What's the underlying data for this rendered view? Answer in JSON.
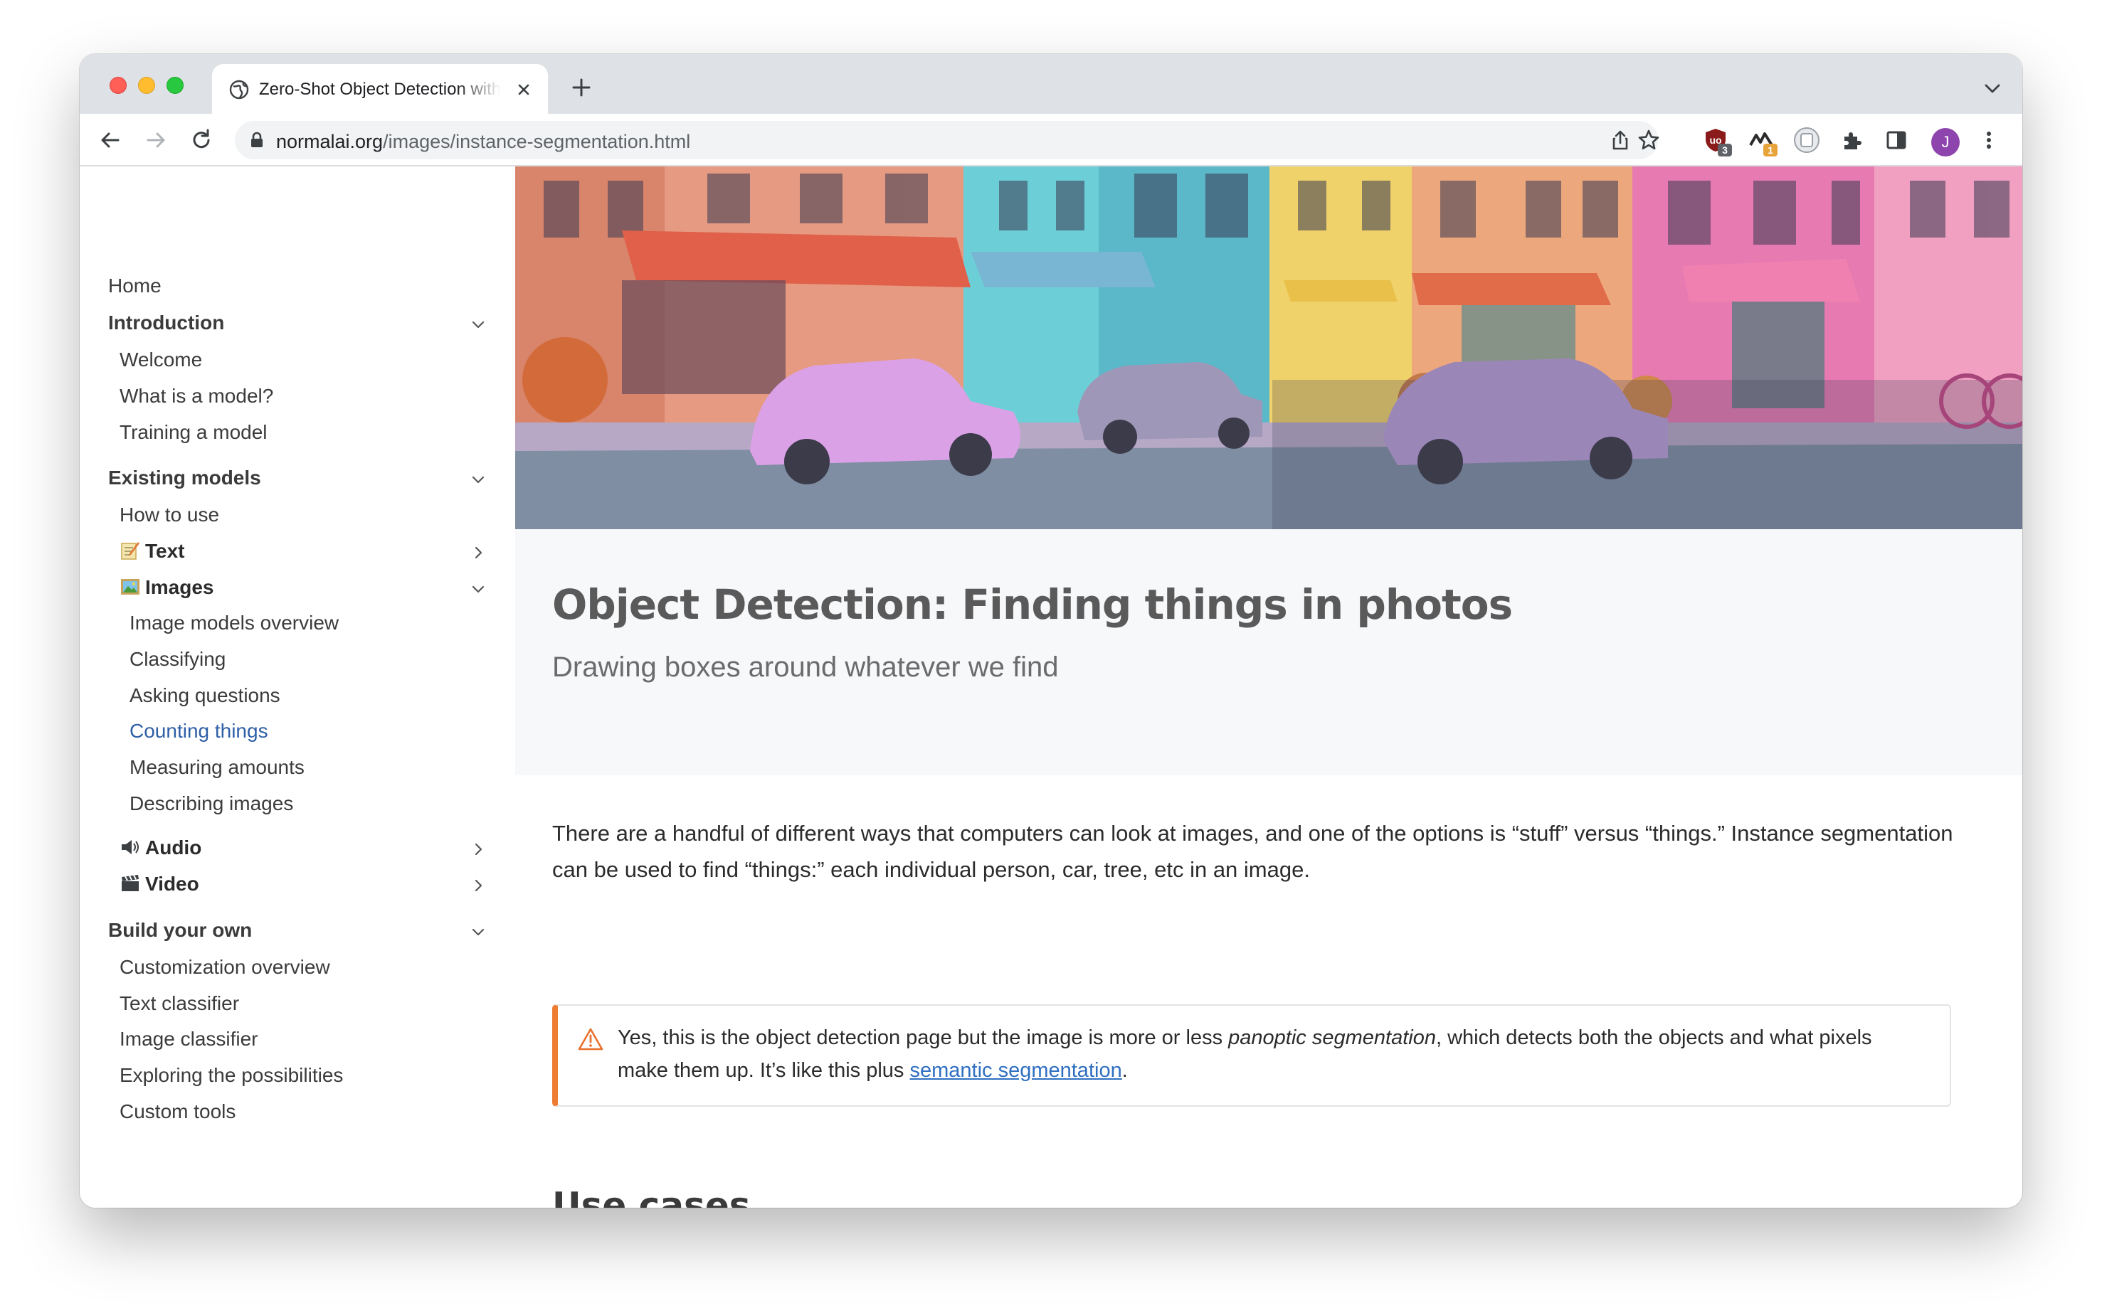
{
  "browser": {
    "tab_title": "Zero-Shot Object Detection with",
    "url_host": "normalai.org",
    "url_path": "/images/instance-segmentation.html",
    "extensions": [
      {
        "name": "ublock-origin-icon",
        "badge": "3",
        "badge_color": "#5f6368"
      },
      {
        "name": "wappalyzer-icon",
        "badge": "1",
        "badge_color": "#e8a33a"
      },
      {
        "name": "readability-icon",
        "badge": ""
      }
    ],
    "profile_initial": "J",
    "profile_color": "#8e44ad"
  },
  "sidebar": {
    "home": "Home",
    "introduction": {
      "label": "Introduction",
      "items": [
        "Welcome",
        "What is a model?",
        "Training a model"
      ]
    },
    "existing_models": {
      "label": "Existing models",
      "how_to_use": "How to use",
      "text": "Text",
      "images": {
        "label": "Images",
        "items": [
          "Image models overview",
          "Classifying",
          "Asking questions",
          "Counting things",
          "Measuring amounts",
          "Describing images"
        ],
        "active_item": "Counting things"
      },
      "audio": "Audio",
      "video": "Video"
    },
    "build_your_own": {
      "label": "Build your own",
      "items": [
        "Customization overview",
        "Text classifier",
        "Image classifier",
        "Exploring the possibilities",
        "Custom tools"
      ]
    }
  },
  "main": {
    "title": "Object Detection: Finding things in photos",
    "subtitle": "Drawing boxes around whatever we find",
    "intro_paragraph": "There are a handful of different ways that computers can look at images, and one of the options is “stuff” versus “things.” Instance segmentation can be used to find “things:” each individual person, car, tree, etc in an image.",
    "callout": {
      "text_before": "Yes, this is the object detection page but the image is more or less ",
      "emphasis": "panoptic segmentation",
      "text_middle": ", which detects both the objects and what pixels make them up. It’s like this plus ",
      "link_text": "semantic segmentation",
      "text_after": "."
    },
    "use_cases_heading": "Use cases"
  }
}
